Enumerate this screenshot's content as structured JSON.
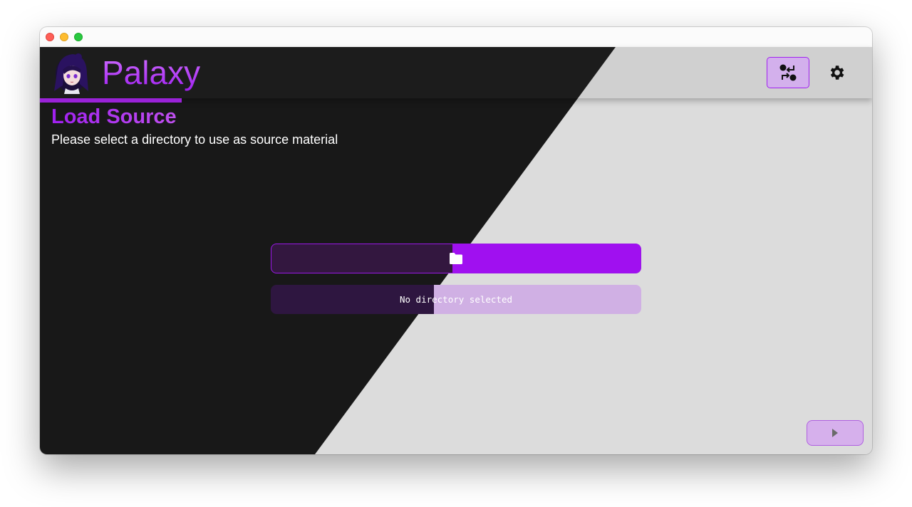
{
  "app": {
    "name": "Palaxy"
  },
  "header": {
    "toggle_icon": "swap-icon",
    "settings_icon": "gear-icon"
  },
  "page": {
    "title": "Load Source",
    "subtitle": "Please select a directory to use as source material",
    "progress": 0.17
  },
  "source": {
    "folder_button_icon": "folder-icon",
    "directory_status": "No directory selected"
  },
  "footer": {
    "next_icon": "play-icon"
  },
  "colors": {
    "accent": "#a010f0",
    "dark_bg": "#181818",
    "light_bg": "#dcdcdc"
  }
}
